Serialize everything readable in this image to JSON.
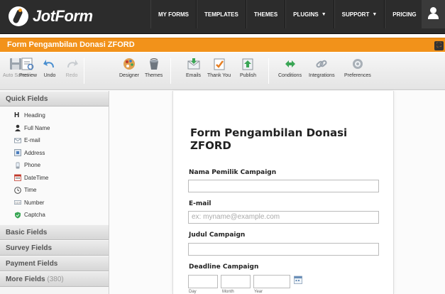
{
  "app": {
    "logo_text": "JotForm"
  },
  "nav": {
    "items": [
      {
        "label": "MY FORMS"
      },
      {
        "label": "TEMPLATES"
      },
      {
        "label": "THEMES"
      },
      {
        "label": "PLUGINS",
        "dropdown": true
      },
      {
        "label": "SUPPORT",
        "dropdown": true
      },
      {
        "label": "PRICING"
      }
    ],
    "user_icon": "user-icon"
  },
  "titlebar": {
    "title": "Form Pengambilan Donasi ZFORD",
    "accent_color": "#f2921a"
  },
  "toolbar": {
    "auto_saved": "Auto Saved",
    "preview": "Preview",
    "undo": "Undo",
    "redo": "Redo",
    "designer": "Designer",
    "themes": "Themes",
    "emails": "Emails",
    "thank_you": "Thank You",
    "publish": "Publish",
    "conditions": "Conditions",
    "integrations": "Integrations",
    "preferences": "Preferences"
  },
  "sidebar": {
    "quick_fields": "Quick Fields",
    "items": [
      {
        "label": "Heading",
        "icon": "heading-icon"
      },
      {
        "label": "Full Name",
        "icon": "person-icon"
      },
      {
        "label": "E-mail",
        "icon": "envelope-icon"
      },
      {
        "label": "Address",
        "icon": "address-icon"
      },
      {
        "label": "Phone",
        "icon": "phone-icon"
      },
      {
        "label": "DateTime",
        "icon": "calendar-icon"
      },
      {
        "label": "Time",
        "icon": "clock-icon"
      },
      {
        "label": "Number",
        "icon": "number-icon"
      },
      {
        "label": "Captcha",
        "icon": "shield-icon"
      }
    ],
    "basic_fields": "Basic Fields",
    "survey_fields": "Survey Fields",
    "payment_fields": "Payment Fields",
    "more_fields": "More Fields",
    "more_fields_count": "(380)"
  },
  "form": {
    "title": "Form Pengambilan Donasi ZFORD",
    "fields": {
      "campaign_owner_label": "Nama Pemilik Campaign",
      "email_label": "E-mail",
      "email_placeholder": "ex: myname@example.com",
      "campaign_title_label": "Judul Campaign",
      "deadline_label": "Deadline Campaign",
      "day_label": "Day",
      "month_label": "Month",
      "year_label": "Year"
    }
  }
}
